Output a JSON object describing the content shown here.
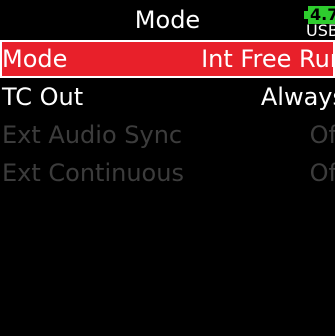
{
  "screen": {
    "title": "Mode",
    "battery": {
      "level": "4.7",
      "source": "USB",
      "color": "#2ecc2e"
    }
  },
  "menu": {
    "items": [
      {
        "label": "Mode",
        "value": "Int Free Run",
        "state": "selected"
      },
      {
        "label": "TC Out",
        "value": "Always",
        "state": "enabled"
      },
      {
        "label": "Ext Audio Sync",
        "value": "Off",
        "state": "disabled"
      },
      {
        "label": "Ext Continuous",
        "value": "Off",
        "state": "disabled"
      }
    ]
  },
  "colors": {
    "selection": "#e8202a",
    "disabled_text": "#3c3c3c",
    "background": "#000000",
    "text": "#ffffff"
  }
}
